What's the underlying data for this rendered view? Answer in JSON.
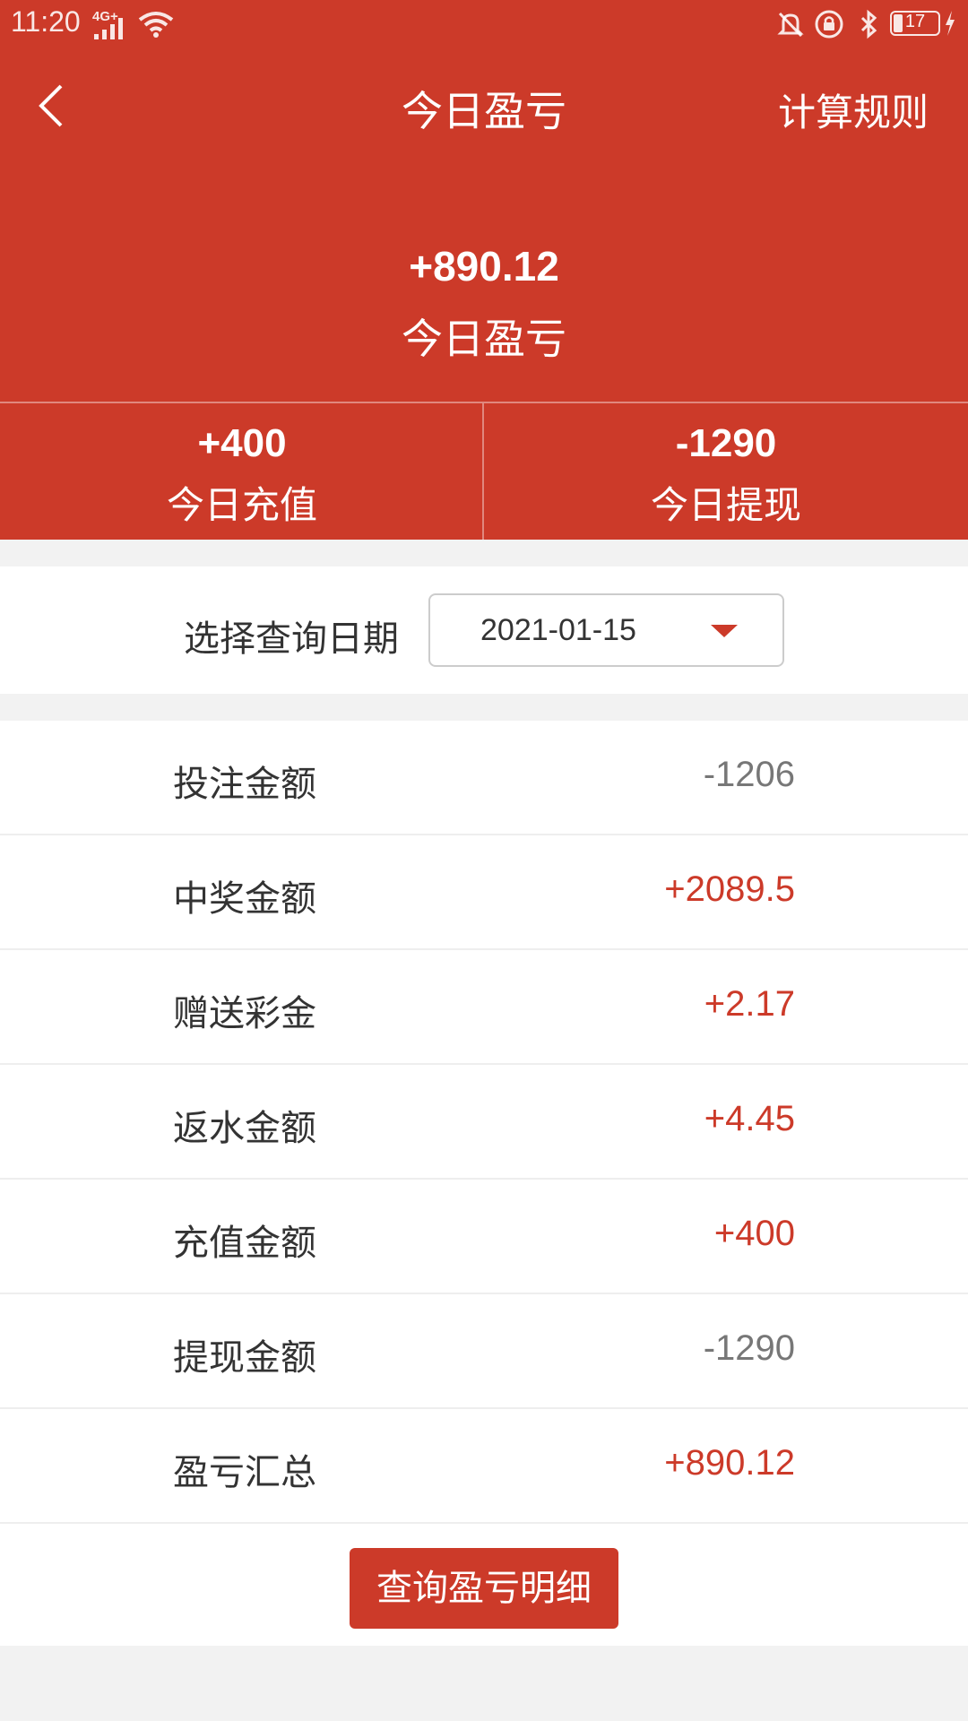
{
  "status_bar": {
    "time": "11:20",
    "network": "4G+",
    "battery": "17"
  },
  "header": {
    "title": "今日盈亏",
    "rules_label": "计算规则"
  },
  "summary": {
    "profit_value": "+890.12",
    "profit_label": "今日盈亏",
    "recharge_value": "+400",
    "recharge_label": "今日充值",
    "withdraw_value": "-1290",
    "withdraw_label": "今日提现"
  },
  "date_filter": {
    "label": "选择查询日期",
    "value": "2021-01-15"
  },
  "rows": [
    {
      "label": "投注金额",
      "value": "-1206"
    },
    {
      "label": "中奖金额",
      "value": "+2089.5"
    },
    {
      "label": "赠送彩金",
      "value": "+2.17"
    },
    {
      "label": "返水金额",
      "value": "+4.45"
    },
    {
      "label": "充值金额",
      "value": "+400"
    },
    {
      "label": "提现金额",
      "value": "-1290"
    },
    {
      "label": "盈亏汇总",
      "value": "+890.12"
    }
  ],
  "detail_button": "查询盈亏明细",
  "colors": {
    "brand": "#cc3a29",
    "positive": "#cc3a29",
    "negative": "#777777"
  }
}
